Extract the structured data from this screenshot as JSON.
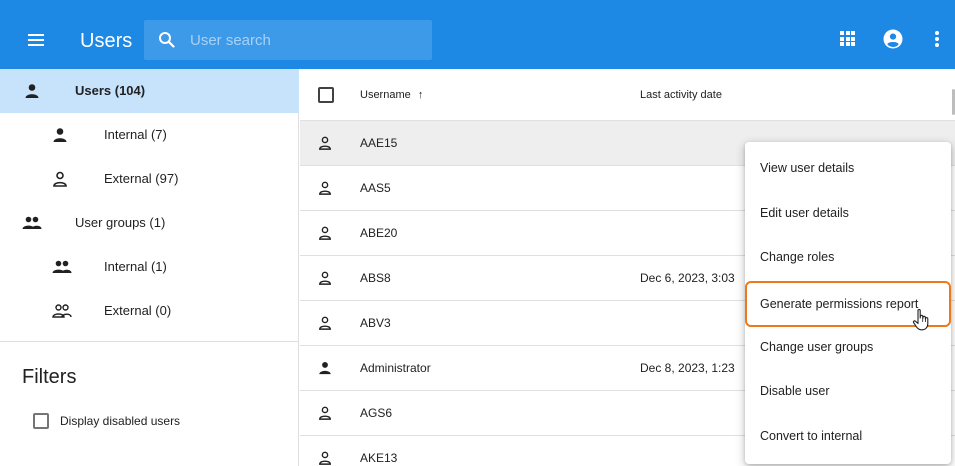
{
  "appbar": {
    "title": "Users",
    "search_placeholder": "User search",
    "icons": [
      "menu-icon",
      "search-icon",
      "apps-icon",
      "account-circle-icon",
      "more-vert-icon"
    ],
    "color": "#1e88e5"
  },
  "sidebar": {
    "items": [
      {
        "label": "Users (104)",
        "icon": "person-icon",
        "active": true
      },
      {
        "label": "Internal (7)",
        "icon": "person-icon"
      },
      {
        "label": "External (97)",
        "icon": "person-outline-icon"
      },
      {
        "label": "User groups (1)",
        "icon": "group-icon"
      },
      {
        "label": "Internal (1)",
        "icon": "group-icon"
      },
      {
        "label": "External (0)",
        "icon": "group-outline-icon"
      }
    ],
    "filters_title": "Filters",
    "filter_checkbox_label": "Display disabled users",
    "active_color": "#c7e2fb"
  },
  "table": {
    "columns": [
      "Username",
      "Last activity date"
    ],
    "sort_indicator": "↑",
    "rows": [
      {
        "username": "AAE15",
        "last_activity": "",
        "icon": "person-outline-icon"
      },
      {
        "username": "AAS5",
        "last_activity": "",
        "icon": "person-outline-icon"
      },
      {
        "username": "ABE20",
        "last_activity": "",
        "icon": "person-outline-icon"
      },
      {
        "username": "ABS8",
        "last_activity": "Dec 6, 2023, 3:03",
        "icon": "person-outline-icon"
      },
      {
        "username": "ABV3",
        "last_activity": "",
        "icon": "person-outline-icon"
      },
      {
        "username": "Administrator",
        "last_activity": "Dec 8, 2023, 1:23",
        "icon": "person-icon"
      },
      {
        "username": "AGS6",
        "last_activity": "",
        "icon": "person-outline-icon"
      },
      {
        "username": "AKE13",
        "last_activity": "",
        "icon": "person-outline-icon"
      }
    ]
  },
  "context_menu": {
    "items": [
      "View user details",
      "Edit user details",
      "Change roles",
      "Generate permissions report",
      "Change user groups",
      "Disable user",
      "Convert to internal"
    ],
    "highlight_color": "#ec7a1c"
  }
}
